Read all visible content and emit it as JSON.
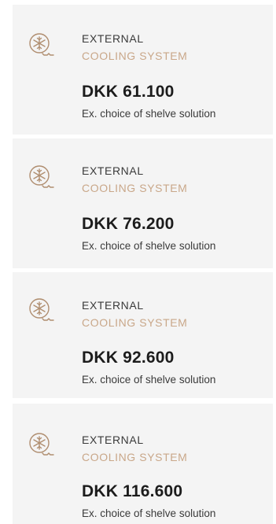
{
  "accent_color": "#c9a789",
  "cards": [
    {
      "icon": "cooling-snowflake-icon",
      "label_line1": "EXTERNAL",
      "label_line2": "COOLING SYSTEM",
      "price": "DKK 61.100",
      "note": "Ex. choice of shelve solution"
    },
    {
      "icon": "cooling-snowflake-icon",
      "label_line1": "EXTERNAL",
      "label_line2": "COOLING SYSTEM",
      "price": "DKK 76.200",
      "note": "Ex. choice of shelve solution"
    },
    {
      "icon": "cooling-snowflake-icon",
      "label_line1": "EXTERNAL",
      "label_line2": "COOLING SYSTEM",
      "price": "DKK 92.600",
      "note": "Ex. choice of shelve solution"
    },
    {
      "icon": "cooling-snowflake-icon",
      "label_line1": "EXTERNAL",
      "label_line2": "COOLING SYSTEM",
      "price": "DKK 116.600",
      "note": "Ex. choice of shelve solution"
    }
  ]
}
